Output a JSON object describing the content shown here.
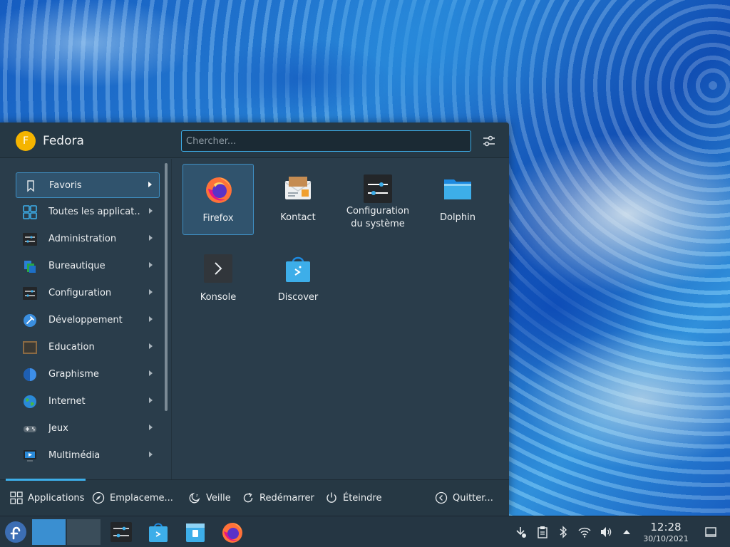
{
  "launcher": {
    "user_initial": "F",
    "user_name": "Fedora",
    "search_placeholder": "Chercher...",
    "categories": [
      {
        "label": "Favoris",
        "icon": "bookmark-icon"
      },
      {
        "label": "Toutes les applicat...",
        "icon": "all-apps-grid-icon"
      },
      {
        "label": "Administration",
        "icon": "administration-icon"
      },
      {
        "label": "Bureautique",
        "icon": "office-icon"
      },
      {
        "label": "Configuration",
        "icon": "configuration-icon"
      },
      {
        "label": "Développement",
        "icon": "development-icon"
      },
      {
        "label": "Éducation",
        "icon": "education-icon"
      },
      {
        "label": "Graphisme",
        "icon": "graphics-icon"
      },
      {
        "label": "Internet",
        "icon": "internet-globe-icon"
      },
      {
        "label": "Jeux",
        "icon": "games-gamepad-icon"
      },
      {
        "label": "Multimédia",
        "icon": "multimedia-icon"
      }
    ],
    "favorites": [
      {
        "label": "Firefox",
        "icon": "firefox-icon"
      },
      {
        "label": "Kontact",
        "icon": "kontact-icon"
      },
      {
        "label": "Configuration du système",
        "icon": "system-settings-icon"
      },
      {
        "label": "Dolphin",
        "icon": "dolphin-folder-icon"
      },
      {
        "label": "Konsole",
        "icon": "konsole-terminal-icon"
      },
      {
        "label": "Discover",
        "icon": "discover-bag-icon"
      }
    ],
    "footer": {
      "applications": "Applications",
      "places": "Emplaceme...",
      "sleep": "Veille",
      "restart": "Redémarrer",
      "shutdown": "Éteindre",
      "logout": "Quitter..."
    }
  },
  "taskbar": {
    "clock_time": "12:28",
    "clock_date": "30/10/2021"
  },
  "colors": {
    "accent": "#3daee9",
    "panel": "#2a3d4b",
    "taskbar": "#253643"
  }
}
